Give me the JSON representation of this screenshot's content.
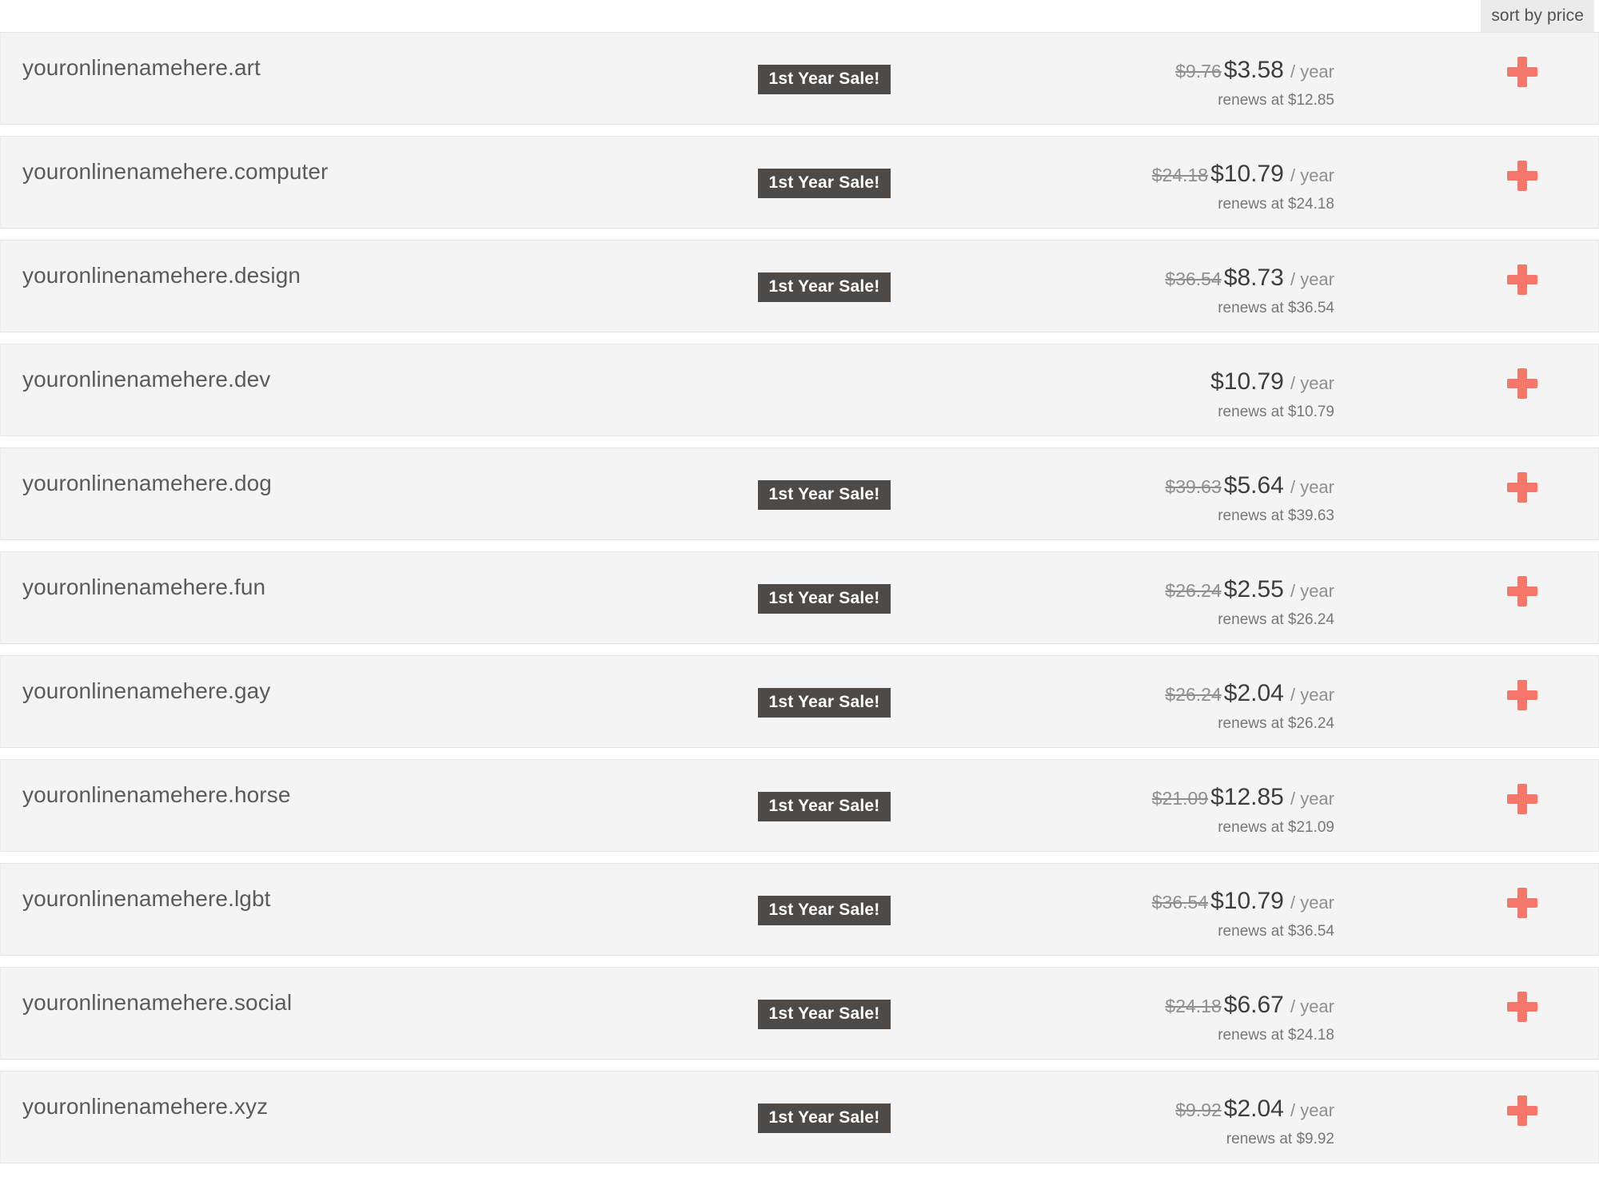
{
  "toolbar": {
    "sort_label": "sort by price"
  },
  "colors": {
    "row_background": "#f4f4f4",
    "badge_background": "#4d4a47",
    "add_icon": "#f4776a",
    "sort_button_background": "#ebebeb"
  },
  "labels": {
    "period": "/ year",
    "renews_prefix": "renews at",
    "sale_badge": "1st Year Sale!",
    "add_icon_name": "plus-icon"
  },
  "results": [
    {
      "domain": "youronlinenamehere.art",
      "badge": "1st Year Sale!",
      "has_badge": true,
      "old_price": "$9.76",
      "price": "$3.58",
      "period": "/ year",
      "renews": "renews at $12.85"
    },
    {
      "domain": "youronlinenamehere.computer",
      "badge": "1st Year Sale!",
      "has_badge": true,
      "old_price": "$24.18",
      "price": "$10.79",
      "period": "/ year",
      "renews": "renews at $24.18"
    },
    {
      "domain": "youronlinenamehere.design",
      "badge": "1st Year Sale!",
      "has_badge": true,
      "old_price": "$36.54",
      "price": "$8.73",
      "period": "/ year",
      "renews": "renews at $36.54"
    },
    {
      "domain": "youronlinenamehere.dev",
      "badge": "",
      "has_badge": false,
      "old_price": "",
      "price": "$10.79",
      "period": "/ year",
      "renews": "renews at $10.79"
    },
    {
      "domain": "youronlinenamehere.dog",
      "badge": "1st Year Sale!",
      "has_badge": true,
      "old_price": "$39.63",
      "price": "$5.64",
      "period": "/ year",
      "renews": "renews at $39.63"
    },
    {
      "domain": "youronlinenamehere.fun",
      "badge": "1st Year Sale!",
      "has_badge": true,
      "old_price": "$26.24",
      "price": "$2.55",
      "period": "/ year",
      "renews": "renews at $26.24"
    },
    {
      "domain": "youronlinenamehere.gay",
      "badge": "1st Year Sale!",
      "has_badge": true,
      "old_price": "$26.24",
      "price": "$2.04",
      "period": "/ year",
      "renews": "renews at $26.24"
    },
    {
      "domain": "youronlinenamehere.horse",
      "badge": "1st Year Sale!",
      "has_badge": true,
      "old_price": "$21.09",
      "price": "$12.85",
      "period": "/ year",
      "renews": "renews at $21.09"
    },
    {
      "domain": "youronlinenamehere.lgbt",
      "badge": "1st Year Sale!",
      "has_badge": true,
      "old_price": "$36.54",
      "price": "$10.79",
      "period": "/ year",
      "renews": "renews at $36.54"
    },
    {
      "domain": "youronlinenamehere.social",
      "badge": "1st Year Sale!",
      "has_badge": true,
      "old_price": "$24.18",
      "price": "$6.67",
      "period": "/ year",
      "renews": "renews at $24.18"
    },
    {
      "domain": "youronlinenamehere.xyz",
      "badge": "1st Year Sale!",
      "has_badge": true,
      "old_price": "$9.92",
      "price": "$2.04",
      "period": "/ year",
      "renews": "renews at $9.92"
    }
  ]
}
